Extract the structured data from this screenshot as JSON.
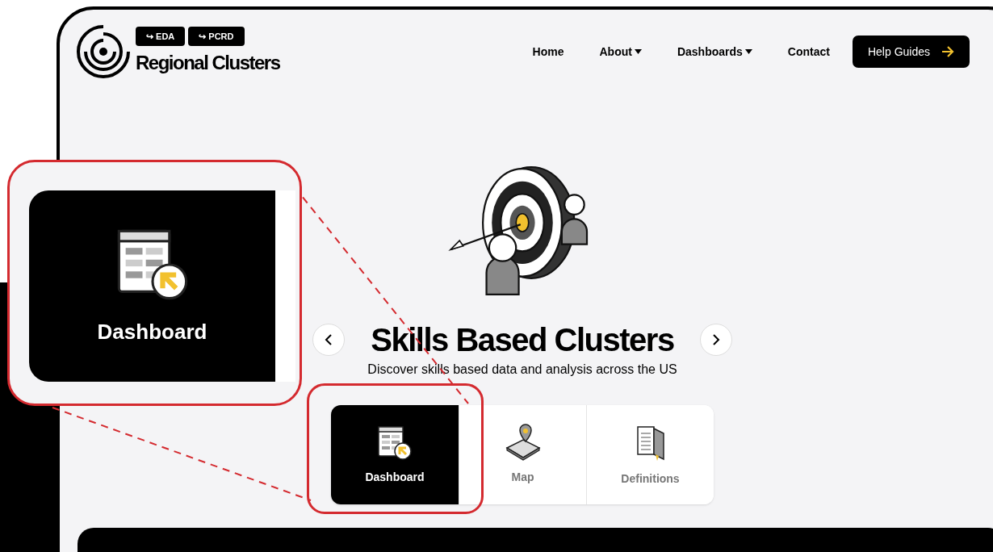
{
  "header": {
    "badges": [
      {
        "label": "EDA",
        "icon": "↪"
      },
      {
        "label": "PCRD",
        "icon": "↪"
      }
    ],
    "site_title": "Regional Clusters"
  },
  "nav": {
    "items": [
      {
        "label": "Home",
        "dropdown": false
      },
      {
        "label": "About",
        "dropdown": true
      },
      {
        "label": "Dashboards",
        "dropdown": true
      },
      {
        "label": "Contact",
        "dropdown": false
      }
    ],
    "cta": "Help Guides"
  },
  "hero": {
    "title": "Skills Based Clusters",
    "subtitle": "Discover skills based data and analysis across the US"
  },
  "tiles": [
    {
      "kind": "dashboard",
      "label": "Dashboard",
      "selected": true
    },
    {
      "kind": "map",
      "label": "Map",
      "selected": false
    },
    {
      "kind": "definitions",
      "label": "Definitions",
      "selected": false
    }
  ],
  "callout": {
    "label": "Dashboard"
  }
}
